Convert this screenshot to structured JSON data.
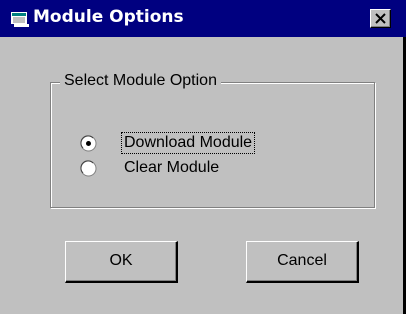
{
  "window": {
    "title": "Module Options",
    "icon": "application-icon",
    "close_icon": "close-icon"
  },
  "group": {
    "label": "Select Module Option"
  },
  "options": [
    {
      "label": "Download Module",
      "selected": true,
      "focused": true
    },
    {
      "label": "Clear Module",
      "selected": false,
      "focused": false
    }
  ],
  "buttons": {
    "ok_label": "OK",
    "cancel_label": "Cancel"
  },
  "colors": {
    "title_bar": "#000080",
    "face": "#c0c0c0",
    "title_text": "#ffffff"
  }
}
